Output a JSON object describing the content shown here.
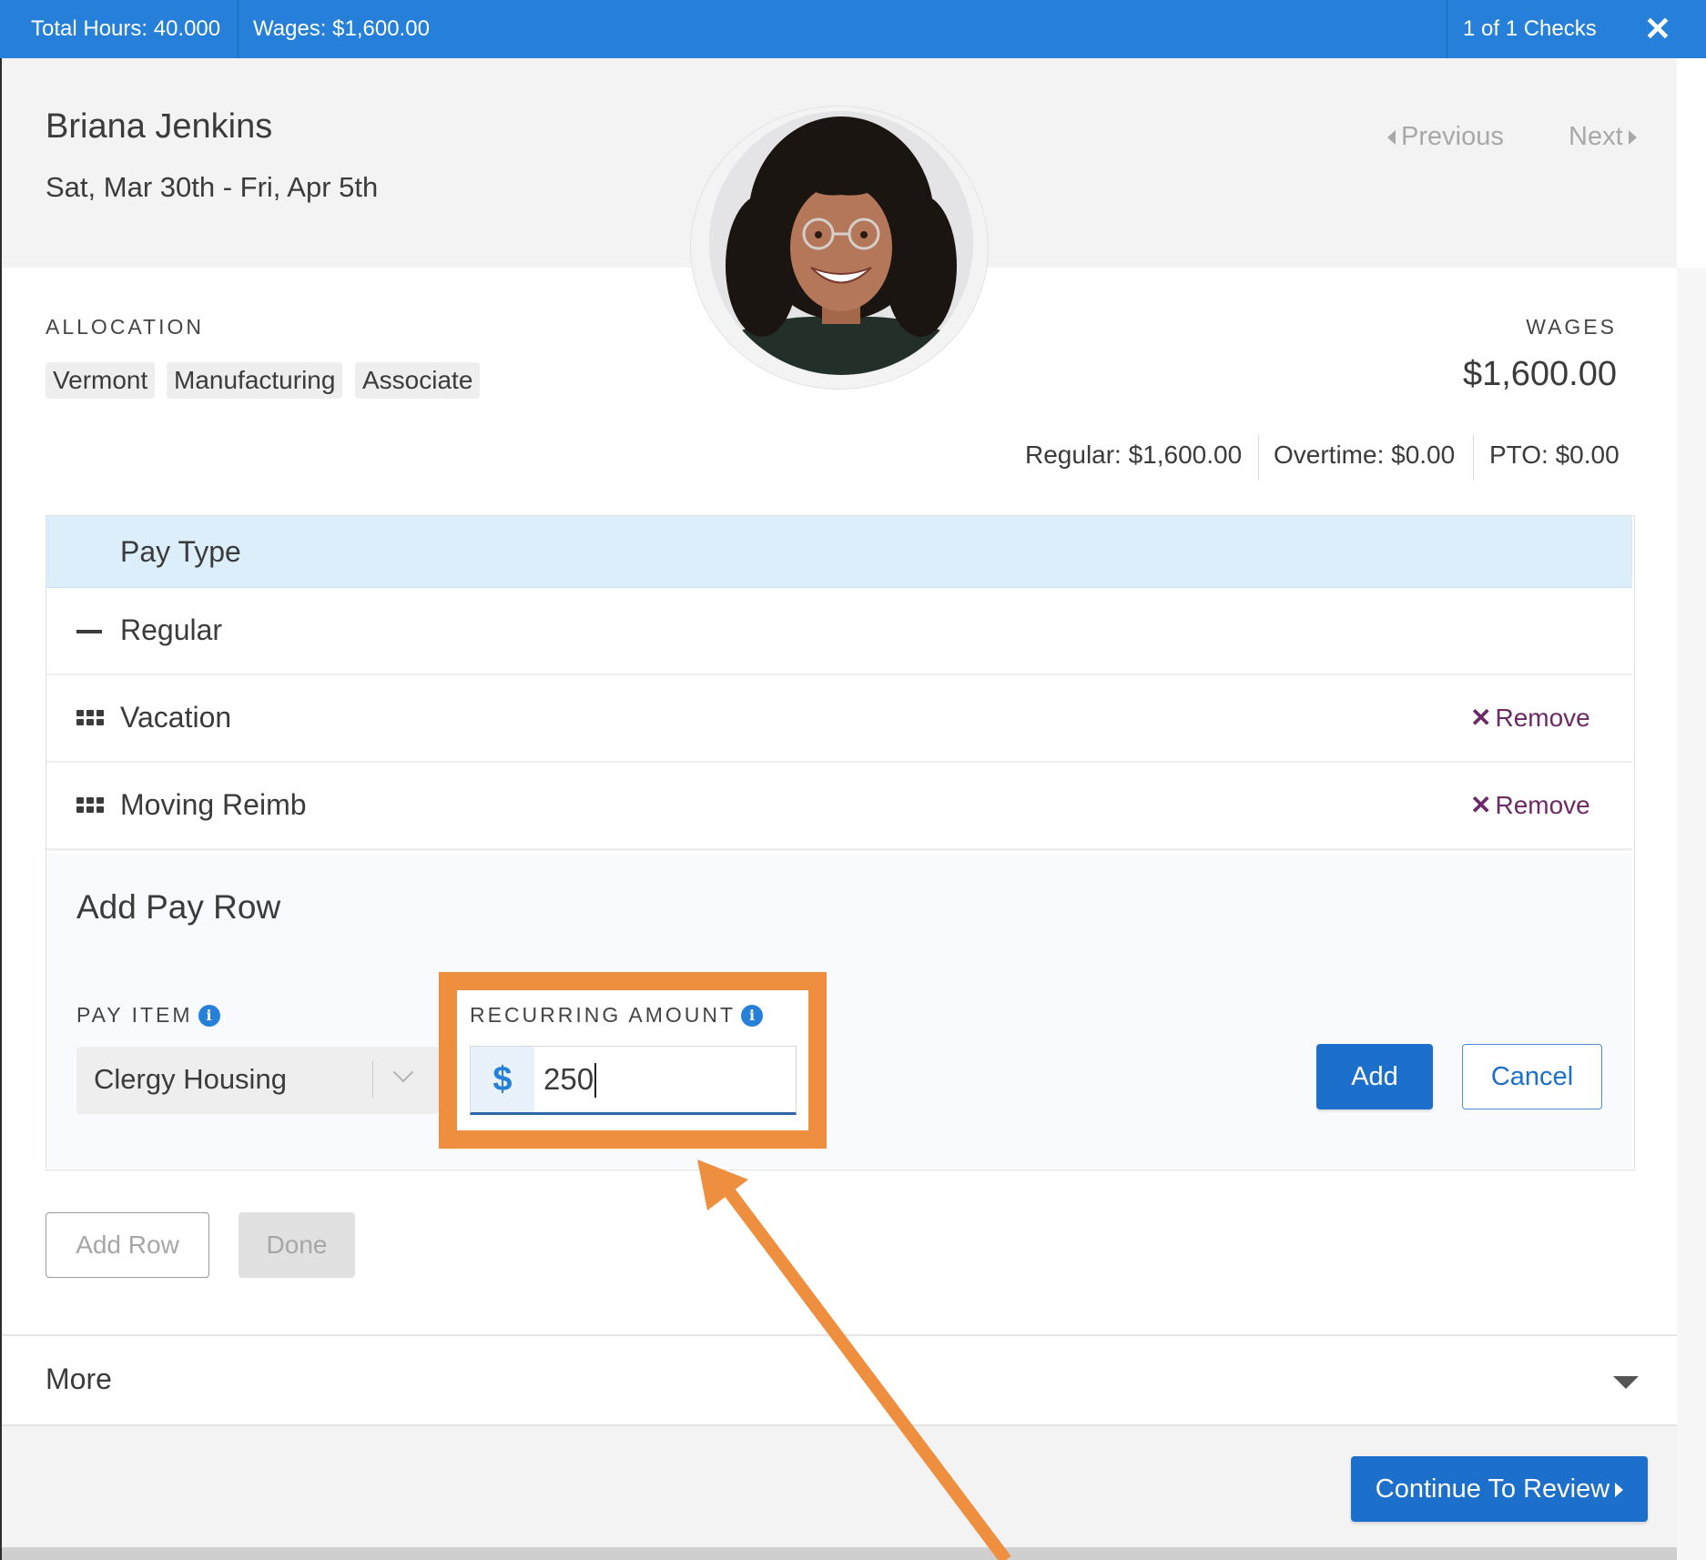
{
  "topbar": {
    "total_hours": "Total Hours: 40.000",
    "wages": "Wages: $1,600.00",
    "checks": "1 of 1 Checks",
    "close_icon": "close-icon"
  },
  "employee": {
    "name": "Briana Jenkins",
    "period": "Sat, Mar 30th - Fri, Apr 5th"
  },
  "navigation": {
    "previous": "Previous",
    "next": "Next"
  },
  "allocation": {
    "label": "ALLOCATION",
    "tags": [
      "Vermont",
      "Manufacturing",
      "Associate"
    ]
  },
  "wages_summary": {
    "label": "WAGES",
    "total": "$1,600.00",
    "regular": "Regular: $1,600.00",
    "overtime": "Overtime: $0.00",
    "pto": "PTO: $0.00"
  },
  "pay_table": {
    "header": "Pay Type",
    "rows": [
      {
        "label": "Regular",
        "icon": "collapse-icon",
        "removable": false
      },
      {
        "label": "Vacation",
        "icon": "drag-handle-icon",
        "removable": true
      },
      {
        "label": "Moving Reimb",
        "icon": "drag-handle-icon",
        "removable": true
      }
    ],
    "remove_label": "Remove"
  },
  "add_pay_row": {
    "title": "Add Pay Row",
    "pay_item_label": "PAY ITEM",
    "pay_item_value": "Clergy Housing",
    "recurring_amount_label": "RECURRING AMOUNT",
    "currency_symbol": "$",
    "recurring_amount_value": "250",
    "add_label": "Add",
    "cancel_label": "Cancel"
  },
  "actions": {
    "add_row": "Add Row",
    "done": "Done"
  },
  "more": {
    "label": "More"
  },
  "footer": {
    "continue_label": "Continue To Review"
  },
  "colors": {
    "primary": "#2680d9",
    "highlight": "#ee8e3f",
    "remove": "#6b2a66"
  }
}
